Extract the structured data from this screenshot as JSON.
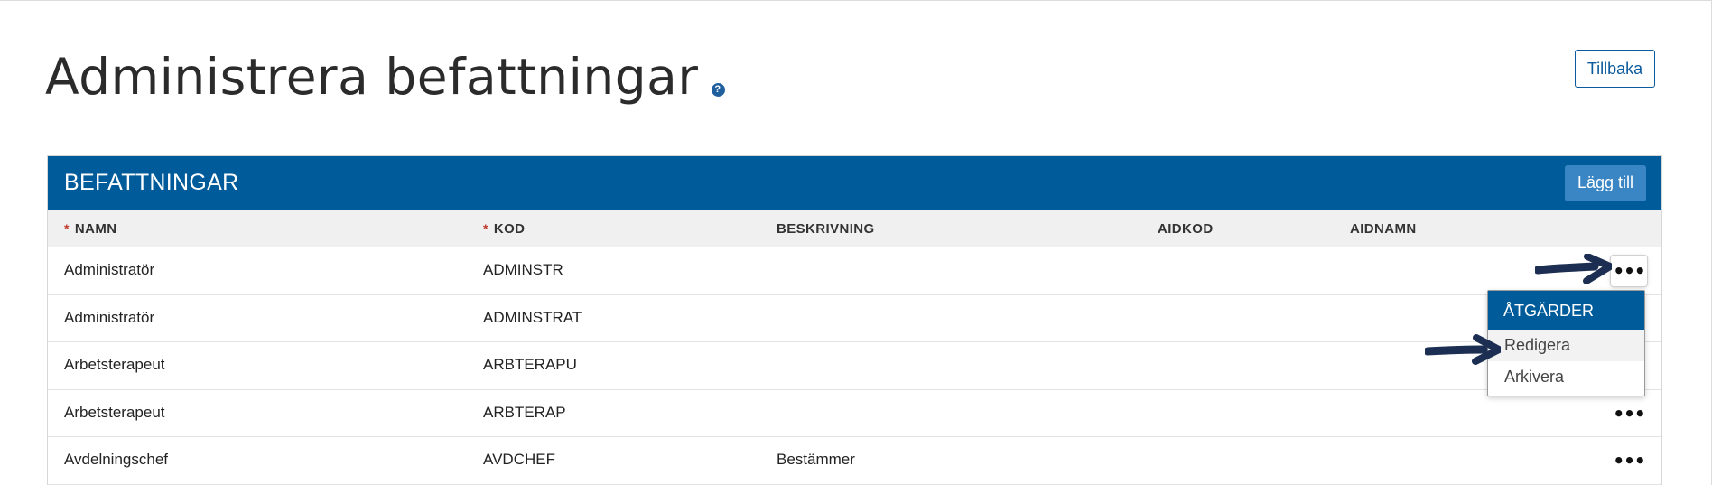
{
  "page": {
    "title": "Administrera befattningar",
    "help_icon": "question-circle-icon",
    "back_label": "Tillbaka"
  },
  "panel": {
    "title": "BEFATTNINGAR",
    "add_label": "Lägg till"
  },
  "table": {
    "required_marker": "*",
    "columns": [
      "NAMN",
      "KOD",
      "BESKRIVNING",
      "AIDKOD",
      "AIDNAMN"
    ],
    "rows": [
      {
        "namn": "Administratör",
        "kod": "ADMINSTR",
        "beskrivning": "",
        "aidkod": "",
        "aidnamn": ""
      },
      {
        "namn": "Administratör",
        "kod": "ADMINSTRAT",
        "beskrivning": "",
        "aidkod": "",
        "aidnamn": ""
      },
      {
        "namn": "Arbetsterapeut",
        "kod": "ARBTERAPU",
        "beskrivning": "",
        "aidkod": "",
        "aidnamn": ""
      },
      {
        "namn": "Arbetsterapeut",
        "kod": "ARBTERAP",
        "beskrivning": "",
        "aidkod": "",
        "aidnamn": ""
      },
      {
        "namn": "Avdelningschef",
        "kod": "AVDCHEF",
        "beskrivning": "Bestämmer",
        "aidkod": "",
        "aidnamn": ""
      }
    ],
    "row_action_label": "•••"
  },
  "actions_menu": {
    "header": "ÅTGÄRDER",
    "items": [
      "Redigera",
      "Arkivera"
    ]
  },
  "colors": {
    "brand": "#005b9a",
    "button_secondary": "#3a86c4",
    "arrow": "#1c2e52"
  }
}
